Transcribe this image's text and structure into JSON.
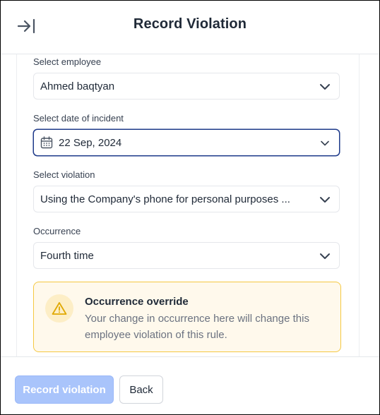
{
  "header": {
    "title": "Record Violation",
    "collapse_icon": "collapse-right-icon"
  },
  "form": {
    "employee": {
      "label": "Select employee",
      "value": "Ahmed baqtyan"
    },
    "date": {
      "label": "Select date of incident",
      "value": "22 Sep, 2024",
      "icon": "calendar-icon"
    },
    "violation": {
      "label": "Select violation",
      "value": "Using the Company's phone for personal purposes ..."
    },
    "occurrence": {
      "label": "Occurrence",
      "value": "Fourth time"
    }
  },
  "alert": {
    "title": "Occurrence override",
    "text": "Your change in occurrence here will change this employee violation of this rule.",
    "icon": "warning-icon"
  },
  "footer": {
    "primary_label": "Record violation",
    "secondary_label": "Back"
  },
  "colors": {
    "primary_disabled": "#a9c4fb",
    "focus_border": "#1e3a8a",
    "alert_border": "#f5c842",
    "alert_bg": "#fff9ec"
  }
}
